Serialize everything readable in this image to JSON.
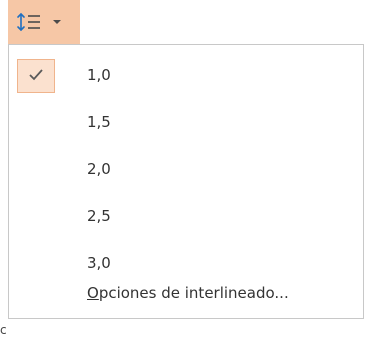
{
  "toolbar": {
    "line_spacing_icon": "line-spacing-icon",
    "dropdown_icon": "caret-down-icon",
    "highlight_color": "#f6c7a6"
  },
  "menu": {
    "selected_index": 0,
    "check_icon": "check-icon",
    "items": [
      {
        "label": "1,0"
      },
      {
        "label": "1,5"
      },
      {
        "label": "2,0"
      },
      {
        "label": "2,5"
      },
      {
        "label": "3,0"
      },
      {
        "label": "Opciones de interlineado..."
      }
    ]
  },
  "stray_text": "c"
}
